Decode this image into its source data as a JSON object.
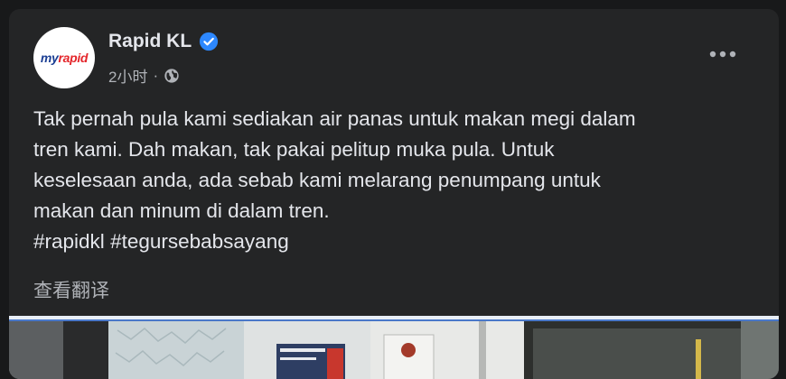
{
  "post": {
    "page_name": "Rapid KL",
    "avatar": {
      "logo_prefix": "my",
      "logo_suffix": "rapid",
      "brand_blue": "#1c3f94",
      "brand_red": "#e4262b"
    },
    "timestamp": "2小时",
    "separator": "·",
    "privacy_icon": "globe-icon",
    "verified_icon": "verified-badge-icon",
    "more_icon": "more-horizontal-icon",
    "text_lines": [
      "Tak pernah pula kami sediakan air panas untuk makan megi dalam",
      "tren kami. Dah makan, tak pakai pelitup muka pula. Untuk",
      "keselesaan anda, ada sebab kami melarang penumpang untuk",
      "makan dan minum di dalam tren."
    ],
    "hashtags": [
      "#rapidkl",
      "#tegursebabsayang"
    ],
    "see_translation": "查看翻译"
  },
  "colors": {
    "page_bg": "#18191a",
    "card_bg": "#242526",
    "primary_text": "#e4e6eb",
    "secondary_text": "#b0b3b8",
    "verified_blue": "#2d88ff"
  }
}
